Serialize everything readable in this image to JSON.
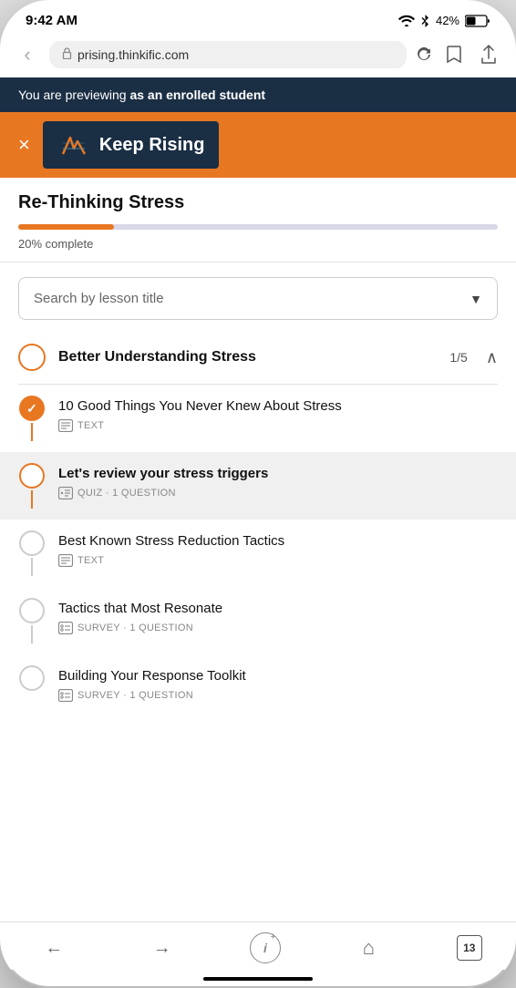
{
  "statusBar": {
    "time": "9:42 AM",
    "wifi": "wifi",
    "bluetooth": "bluetooth",
    "battery": "42%"
  },
  "browser": {
    "backLabel": "‹",
    "address": "prising.thinkific.com",
    "bookmarkIcon": "bookmark",
    "shareIcon": "share"
  },
  "previewBanner": {
    "prefix": "You are previewing ",
    "bold": "as an enrolled student"
  },
  "courseHeader": {
    "closeLabel": "×",
    "logoText": "Keep Rising"
  },
  "courseTitleSection": {
    "title": "Re-Thinking Stress",
    "progressPercent": 20,
    "progressLabel": "20% complete"
  },
  "search": {
    "placeholder": "Search by lesson title",
    "arrowLabel": "▼"
  },
  "chapter": {
    "title": "Better Understanding Stress",
    "count": "1/5",
    "chevronLabel": "∧"
  },
  "lessons": [
    {
      "title": "10 Good Things You Never Knew About Stress",
      "metaType": "TEXT",
      "status": "completed",
      "active": false
    },
    {
      "title": "Let's review your stress triggers",
      "metaType": "QUIZ · 1 QUESTION",
      "status": "current",
      "active": true
    },
    {
      "title": "Best Known Stress Reduction Tactics",
      "metaType": "TEXT",
      "status": "incomplete",
      "active": false
    },
    {
      "title": "Tactics that Most Resonate",
      "metaType": "SURVEY · 1 QUESTION",
      "status": "incomplete",
      "active": false
    },
    {
      "title": "Building Your Response Toolkit",
      "metaType": "SURVEY · 1 QUESTION",
      "status": "incomplete",
      "active": false
    }
  ],
  "bottomNav": {
    "backLabel": "←",
    "forwardLabel": "→",
    "infoLabel": "i",
    "homeLabel": "⌂",
    "tabsLabel": "13"
  }
}
